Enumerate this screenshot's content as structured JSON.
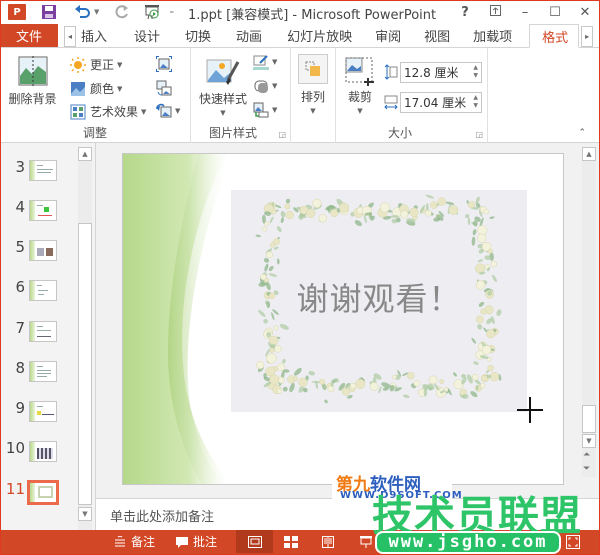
{
  "window": {
    "title": "1.ppt [兼容模式] - Microsoft PowerPoint",
    "buttons": [
      "?",
      "ribbon-display",
      "minimize",
      "maximize",
      "close"
    ]
  },
  "quick_access": {
    "icons": [
      "powerpoint-logo",
      "save-icon",
      "undo-icon",
      "redo-icon",
      "present-from-start-icon",
      "customize-icon"
    ],
    "logo_text": "P"
  },
  "tabs": {
    "file": "文件",
    "items": [
      "插入",
      "设计",
      "切换",
      "动画",
      "幻灯片放映",
      "审阅",
      "视图",
      "加载项",
      "格式"
    ],
    "active": "格式"
  },
  "ribbon": {
    "adjust": {
      "label": "调整",
      "remove_background": "删除背景",
      "corrections": "更正",
      "color": "颜色",
      "artistic_effects": "艺术效果"
    },
    "picture_styles": {
      "label": "图片样式",
      "quick_styles": "快速样式"
    },
    "arrange": {
      "label": "排列"
    },
    "size": {
      "label": "大小",
      "crop": "裁剪",
      "height": "12.8 厘米",
      "width": "17.04 厘米"
    }
  },
  "slides_pane": {
    "slides": [
      {
        "num": "3"
      },
      {
        "num": "4"
      },
      {
        "num": "5"
      },
      {
        "num": "6"
      },
      {
        "num": "7"
      },
      {
        "num": "8"
      },
      {
        "num": "9"
      },
      {
        "num": "10"
      },
      {
        "num": "11"
      }
    ],
    "selected": "11"
  },
  "slide": {
    "text": "谢谢观看！"
  },
  "notes": {
    "placeholder": "单击此处添加备注"
  },
  "statusbar": {
    "notes": "备注",
    "comments": "批注"
  },
  "watermark": {
    "line1a": "第九",
    "line1b": "软件网",
    "line1_url": "WWW.D9SOFT.COM",
    "main": "技术员联盟",
    "url": "www.jsgho.com"
  },
  "colors": {
    "accent": "#d24726",
    "watermark_green": "#2ec468"
  }
}
